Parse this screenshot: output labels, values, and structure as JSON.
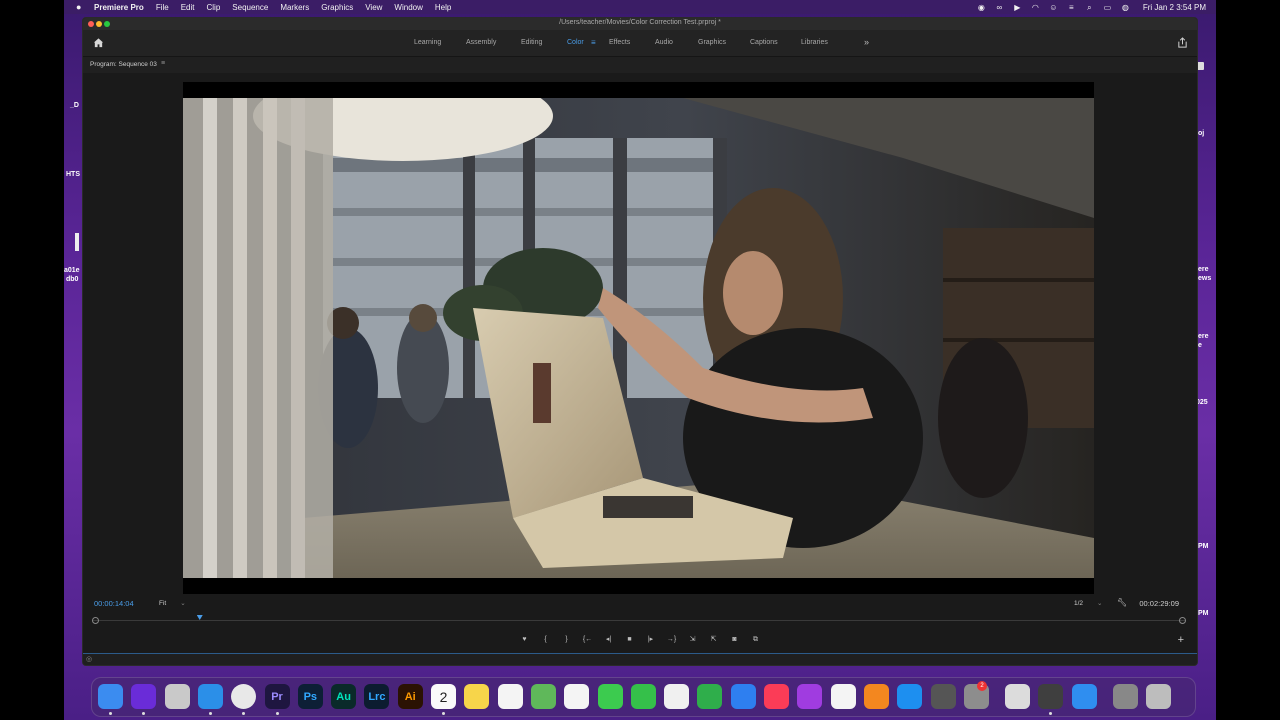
{
  "menubar": {
    "app_name": "Premiere Pro",
    "items": [
      "File",
      "Edit",
      "Clip",
      "Sequence",
      "Markers",
      "Graphics",
      "View",
      "Window",
      "Help"
    ],
    "clock": "Fri Jan 2  3:54 PM"
  },
  "desktop_fragments": [
    "_D",
    "HTS",
    "a01e",
    "db0",
    "oj",
    "ere",
    "ews",
    "ere",
    "e",
    "025",
    "PM",
    "PM"
  ],
  "window": {
    "title": "/Users/teacher/Movies/Color Correction Test.prproj *",
    "workspaces": [
      "Learning",
      "Assembly",
      "Editing",
      "Color",
      "Effects",
      "Audio",
      "Graphics",
      "Captions",
      "Libraries"
    ],
    "active_workspace": "Color"
  },
  "panel": {
    "title": "Program: Sequence 03",
    "timecode_current": "00:00:14:04",
    "zoom": "Fit",
    "resolution": "1/2",
    "timecode_duration": "00:02:29:09",
    "playhead_fraction": 0.095
  },
  "transport": {
    "buttons": [
      "add-marker",
      "mark-in",
      "mark-out",
      "go-to-in",
      "step-back",
      "stop",
      "step-forward",
      "go-to-out",
      "insert",
      "overwrite",
      "export-frame",
      "comparison-view"
    ]
  },
  "dock": {
    "apps": [
      {
        "name": "finder",
        "label": "",
        "color": "#3b8cf0"
      },
      {
        "name": "siri",
        "label": "",
        "color": "#6a2cd8"
      },
      {
        "name": "launchpad",
        "label": "",
        "color": "#c9c9c9"
      },
      {
        "name": "safari",
        "label": "",
        "color": "#2b8fe8"
      },
      {
        "name": "chrome",
        "label": "",
        "color": "#e8e8e8"
      },
      {
        "name": "premiere",
        "label": "Pr",
        "color": "#1e1640"
      },
      {
        "name": "photoshop",
        "label": "Ps",
        "color": "#0d1f36"
      },
      {
        "name": "audition",
        "label": "Au",
        "color": "#0a2a2a"
      },
      {
        "name": "lightroom-classic",
        "label": "Lrc",
        "color": "#0c1c30"
      },
      {
        "name": "illustrator",
        "label": "Ai",
        "color": "#2b1203"
      },
      {
        "name": "calendar",
        "label": "2",
        "color": "#fafafa"
      },
      {
        "name": "notes",
        "label": "",
        "color": "#f7d54a"
      },
      {
        "name": "reminders",
        "label": "",
        "color": "#f4f4f4"
      },
      {
        "name": "maps",
        "label": "",
        "color": "#5fb85a"
      },
      {
        "name": "photos",
        "label": "",
        "color": "#f4f4f4"
      },
      {
        "name": "messages",
        "label": "",
        "color": "#3ccb4f"
      },
      {
        "name": "facetime",
        "label": "",
        "color": "#35c04a"
      },
      {
        "name": "freeform",
        "label": "",
        "color": "#f0f0f0"
      },
      {
        "name": "numbers",
        "label": "",
        "color": "#2fae4b"
      },
      {
        "name": "keynote",
        "label": "",
        "color": "#2e7ff0"
      },
      {
        "name": "music",
        "label": "",
        "color": "#fb3c57"
      },
      {
        "name": "podcasts",
        "label": "",
        "color": "#a03ce0"
      },
      {
        "name": "news",
        "label": "",
        "color": "#f4f4f4"
      },
      {
        "name": "books",
        "label": "",
        "color": "#f3871f"
      },
      {
        "name": "app-store",
        "label": "",
        "color": "#1d8ff0"
      },
      {
        "name": "calculator",
        "label": "",
        "color": "#555555"
      },
      {
        "name": "system-settings",
        "label": "",
        "color": "#8d8d8d"
      },
      {
        "name": "preview",
        "label": "",
        "color": "#dcdcdc"
      },
      {
        "name": "quicktime",
        "label": "",
        "color": "#3f3f3f"
      },
      {
        "name": "mail",
        "label": "",
        "color": "#2f8ef0"
      },
      {
        "name": "downloads",
        "label": "",
        "color": "#888888"
      },
      {
        "name": "trash",
        "label": "",
        "color": "#bdbdbd"
      }
    ],
    "settings_badge": "2"
  },
  "colors": {
    "accent": "#4a9de8",
    "panel_bg": "#1a1a1a"
  }
}
